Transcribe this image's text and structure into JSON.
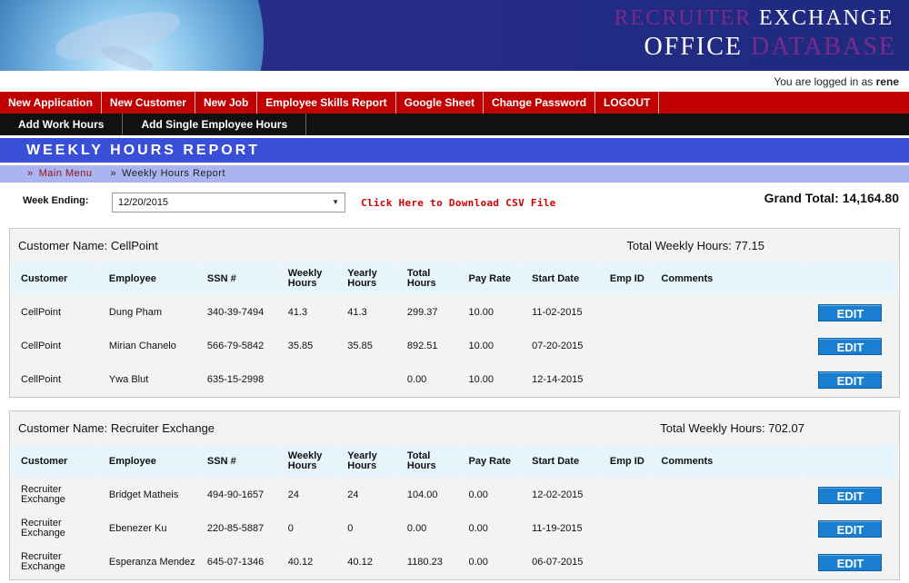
{
  "header": {
    "brand_recruiter": "RECRUITER",
    "brand_exchange": "EXCHANGE",
    "brand_office": "OFFICE",
    "brand_database": "DATABASE",
    "login_prefix": "You are logged in as",
    "username": "rene"
  },
  "nav_main": [
    "New Application",
    "New Customer",
    "New Job",
    "Employee Skills Report",
    "Google Sheet",
    "Change Password",
    "LOGOUT"
  ],
  "nav_sub": [
    "Add Work Hours",
    "Add Single Employee Hours"
  ],
  "page": {
    "title": "WEEKLY HOURS REPORT",
    "breadcrumb_sep": "»",
    "breadcrumb_main": "Main Menu",
    "breadcrumb_current": "Weekly Hours Report",
    "week_label": "Week Ending:",
    "week_value": "12/20/2015",
    "csv_link": "Click Here to Download CSV File",
    "grand_total": "Grand Total: 14,164.80"
  },
  "columns": [
    "Customer",
    "Employee",
    "SSN #",
    "Weekly Hours",
    "Yearly Hours",
    "Total Hours",
    "Pay Rate",
    "Start Date",
    "Emp ID",
    "Comments"
  ],
  "edit_label": "EDIT",
  "groups": [
    {
      "customer_name": "Customer Name: CellPoint",
      "total_weekly": "Total Weekly Hours: 77.15",
      "rows": [
        [
          "CellPoint",
          "Dung Pham",
          "340-39-7494",
          "41.3",
          "41.3",
          "299.37",
          "10.00",
          "11-02-2015",
          "",
          ""
        ],
        [
          "CellPoint",
          "Mirian Chanelo",
          "566-79-5842",
          "35.85",
          "35.85",
          "892.51",
          "10.00",
          "07-20-2015",
          "",
          ""
        ],
        [
          "CellPoint",
          "Ywa Blut",
          "635-15-2998",
          "",
          "",
          "0.00",
          "10.00",
          "12-14-2015",
          "",
          ""
        ]
      ]
    },
    {
      "customer_name": "Customer Name: Recruiter Exchange",
      "total_weekly": "Total Weekly Hours: 702.07",
      "rows": [
        [
          "Recruiter Exchange",
          "Bridget Matheis",
          "494-90-1657",
          "24",
          "24",
          "104.00",
          "0.00",
          "12-02-2015",
          "",
          ""
        ],
        [
          "Recruiter Exchange",
          "Ebenezer Ku",
          "220-85-5887",
          "0",
          "0",
          "0.00",
          "0.00",
          "11-19-2015",
          "",
          ""
        ],
        [
          "Recruiter Exchange",
          "Esperanza Mendez",
          "645-07-1346",
          "40.12",
          "40.12",
          "1180.23",
          "0.00",
          "06-07-2015",
          "",
          ""
        ]
      ]
    }
  ]
}
